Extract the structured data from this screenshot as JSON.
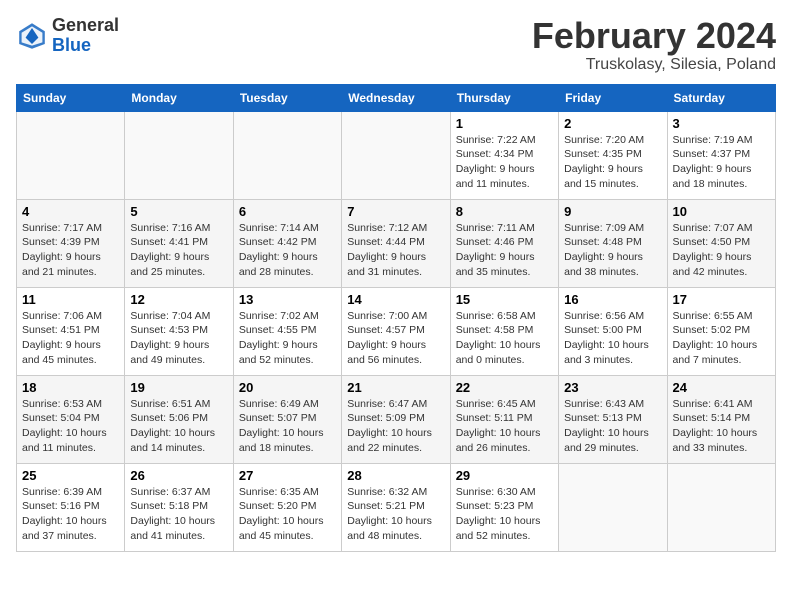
{
  "logo": {
    "general": "General",
    "blue": "Blue"
  },
  "title": {
    "month": "February 2024",
    "location": "Truskolasy, Silesia, Poland"
  },
  "days_of_week": [
    "Sunday",
    "Monday",
    "Tuesday",
    "Wednesday",
    "Thursday",
    "Friday",
    "Saturday"
  ],
  "weeks": [
    [
      {
        "day": "",
        "detail": ""
      },
      {
        "day": "",
        "detail": ""
      },
      {
        "day": "",
        "detail": ""
      },
      {
        "day": "",
        "detail": ""
      },
      {
        "day": "1",
        "detail": "Sunrise: 7:22 AM\nSunset: 4:34 PM\nDaylight: 9 hours\nand 11 minutes."
      },
      {
        "day": "2",
        "detail": "Sunrise: 7:20 AM\nSunset: 4:35 PM\nDaylight: 9 hours\nand 15 minutes."
      },
      {
        "day": "3",
        "detail": "Sunrise: 7:19 AM\nSunset: 4:37 PM\nDaylight: 9 hours\nand 18 minutes."
      }
    ],
    [
      {
        "day": "4",
        "detail": "Sunrise: 7:17 AM\nSunset: 4:39 PM\nDaylight: 9 hours\nand 21 minutes."
      },
      {
        "day": "5",
        "detail": "Sunrise: 7:16 AM\nSunset: 4:41 PM\nDaylight: 9 hours\nand 25 minutes."
      },
      {
        "day": "6",
        "detail": "Sunrise: 7:14 AM\nSunset: 4:42 PM\nDaylight: 9 hours\nand 28 minutes."
      },
      {
        "day": "7",
        "detail": "Sunrise: 7:12 AM\nSunset: 4:44 PM\nDaylight: 9 hours\nand 31 minutes."
      },
      {
        "day": "8",
        "detail": "Sunrise: 7:11 AM\nSunset: 4:46 PM\nDaylight: 9 hours\nand 35 minutes."
      },
      {
        "day": "9",
        "detail": "Sunrise: 7:09 AM\nSunset: 4:48 PM\nDaylight: 9 hours\nand 38 minutes."
      },
      {
        "day": "10",
        "detail": "Sunrise: 7:07 AM\nSunset: 4:50 PM\nDaylight: 9 hours\nand 42 minutes."
      }
    ],
    [
      {
        "day": "11",
        "detail": "Sunrise: 7:06 AM\nSunset: 4:51 PM\nDaylight: 9 hours\nand 45 minutes."
      },
      {
        "day": "12",
        "detail": "Sunrise: 7:04 AM\nSunset: 4:53 PM\nDaylight: 9 hours\nand 49 minutes."
      },
      {
        "day": "13",
        "detail": "Sunrise: 7:02 AM\nSunset: 4:55 PM\nDaylight: 9 hours\nand 52 minutes."
      },
      {
        "day": "14",
        "detail": "Sunrise: 7:00 AM\nSunset: 4:57 PM\nDaylight: 9 hours\nand 56 minutes."
      },
      {
        "day": "15",
        "detail": "Sunrise: 6:58 AM\nSunset: 4:58 PM\nDaylight: 10 hours\nand 0 minutes."
      },
      {
        "day": "16",
        "detail": "Sunrise: 6:56 AM\nSunset: 5:00 PM\nDaylight: 10 hours\nand 3 minutes."
      },
      {
        "day": "17",
        "detail": "Sunrise: 6:55 AM\nSunset: 5:02 PM\nDaylight: 10 hours\nand 7 minutes."
      }
    ],
    [
      {
        "day": "18",
        "detail": "Sunrise: 6:53 AM\nSunset: 5:04 PM\nDaylight: 10 hours\nand 11 minutes."
      },
      {
        "day": "19",
        "detail": "Sunrise: 6:51 AM\nSunset: 5:06 PM\nDaylight: 10 hours\nand 14 minutes."
      },
      {
        "day": "20",
        "detail": "Sunrise: 6:49 AM\nSunset: 5:07 PM\nDaylight: 10 hours\nand 18 minutes."
      },
      {
        "day": "21",
        "detail": "Sunrise: 6:47 AM\nSunset: 5:09 PM\nDaylight: 10 hours\nand 22 minutes."
      },
      {
        "day": "22",
        "detail": "Sunrise: 6:45 AM\nSunset: 5:11 PM\nDaylight: 10 hours\nand 26 minutes."
      },
      {
        "day": "23",
        "detail": "Sunrise: 6:43 AM\nSunset: 5:13 PM\nDaylight: 10 hours\nand 29 minutes."
      },
      {
        "day": "24",
        "detail": "Sunrise: 6:41 AM\nSunset: 5:14 PM\nDaylight: 10 hours\nand 33 minutes."
      }
    ],
    [
      {
        "day": "25",
        "detail": "Sunrise: 6:39 AM\nSunset: 5:16 PM\nDaylight: 10 hours\nand 37 minutes."
      },
      {
        "day": "26",
        "detail": "Sunrise: 6:37 AM\nSunset: 5:18 PM\nDaylight: 10 hours\nand 41 minutes."
      },
      {
        "day": "27",
        "detail": "Sunrise: 6:35 AM\nSunset: 5:20 PM\nDaylight: 10 hours\nand 45 minutes."
      },
      {
        "day": "28",
        "detail": "Sunrise: 6:32 AM\nSunset: 5:21 PM\nDaylight: 10 hours\nand 48 minutes."
      },
      {
        "day": "29",
        "detail": "Sunrise: 6:30 AM\nSunset: 5:23 PM\nDaylight: 10 hours\nand 52 minutes."
      },
      {
        "day": "",
        "detail": ""
      },
      {
        "day": "",
        "detail": ""
      }
    ]
  ]
}
